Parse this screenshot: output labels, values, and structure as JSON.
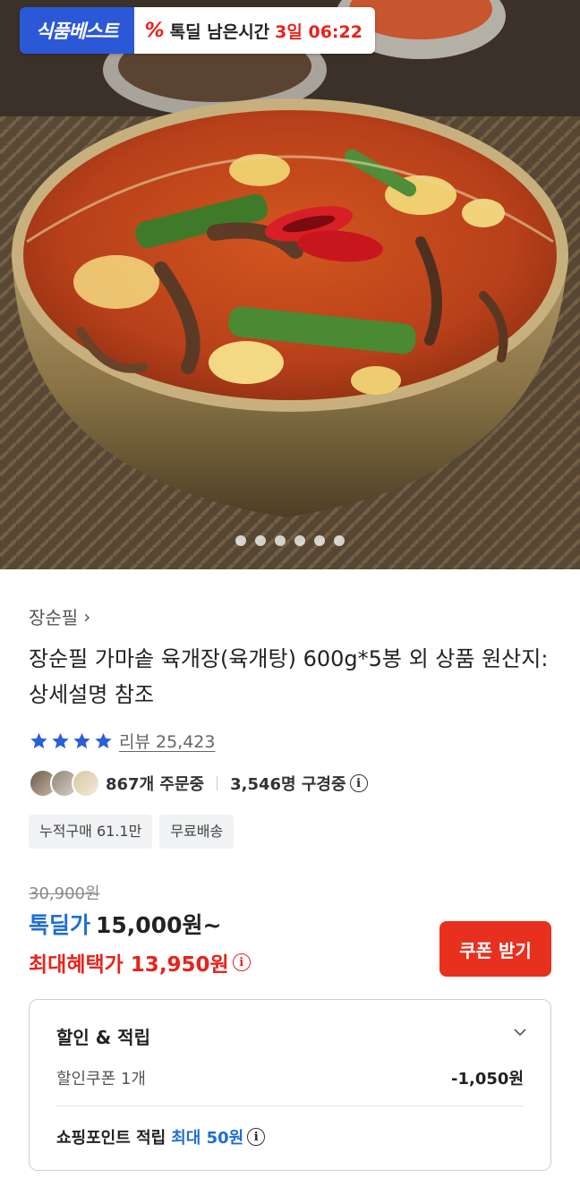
{
  "hero": {
    "brand_badge": "식품베스트",
    "timer_icon": "percent-icon",
    "timer_label": "톡딜 남은시간",
    "timer_value": "3일 06:22",
    "carousel_dots": 6,
    "carousel_active_index": 0
  },
  "product": {
    "seller": "장순필",
    "title": "장순필 가마솥 육개장(육개탕) 600g*5봉 외 상품 원산지: 상세설명 참조",
    "rating_stars": 4,
    "review_text": "리뷰 25,423",
    "orders_text": "867개 주문중",
    "viewers_text": "3,546명 구경중",
    "tags": [
      "누적구매 61.1만",
      "무료배송"
    ]
  },
  "price": {
    "original": "30,900원",
    "deal_label": "톡딜가",
    "deal_price": "15,000원~",
    "max_label": "최대혜택가 13,950원",
    "coupon_button": "쿠폰 받기"
  },
  "benefits": {
    "title": "할인 & 적립",
    "coupon_label": "할인쿠폰 1개",
    "coupon_amount": "-1,050원",
    "point_label": "쇼핑포인트 적립",
    "point_max": "최대 50원"
  },
  "colors": {
    "accent_red": "#e8231d",
    "accent_blue": "#1f6fd0",
    "brand_blue": "#2b58d6",
    "star": "#2a5fd6"
  }
}
